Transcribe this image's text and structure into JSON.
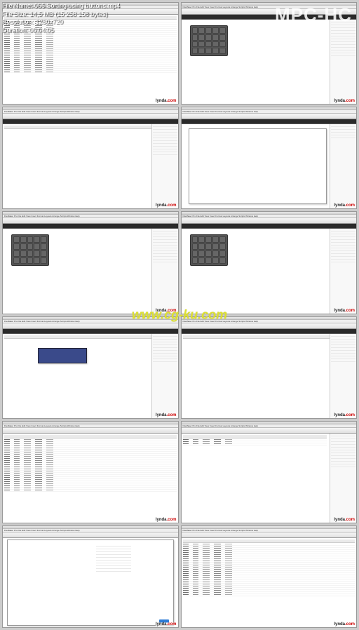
{
  "player": {
    "name": "MPC-HC",
    "info_lines": [
      "File Name: 066 Sorting using buttons.mp4",
      "File Size: 14,5 MB (15 258 158 bytes)",
      "Resolution: 1280x720",
      "Duration: 00:04:05"
    ]
  },
  "watermark": "www.cg-ku.com",
  "thumb_brand": "lynda",
  "thumb_brand_suffix": ".com",
  "app_menu": "FileMaker Pro  File  Edit  View  Insert  Format  Layouts  Arrange  Scripts  Window  Help",
  "table_columns": [
    "Company",
    "Contact Name",
    "Contact Title",
    "City",
    "S",
    "State",
    "Phone Number",
    "Email",
    "Status"
  ],
  "thumbnails": [
    {
      "id": 0,
      "type": "table-full"
    },
    {
      "id": 1,
      "type": "panel-sides"
    },
    {
      "id": 2,
      "type": "sides-light"
    },
    {
      "id": 3,
      "type": "dialog-white"
    },
    {
      "id": 4,
      "type": "panel-sides"
    },
    {
      "id": 5,
      "type": "panel-sides"
    },
    {
      "id": 6,
      "type": "dark-popup"
    },
    {
      "id": 7,
      "type": "sides-blank"
    },
    {
      "id": 8,
      "type": "table-full"
    },
    {
      "id": 9,
      "type": "table-side"
    },
    {
      "id": 10,
      "type": "big-dialog"
    },
    {
      "id": 11,
      "type": "table-full"
    }
  ]
}
